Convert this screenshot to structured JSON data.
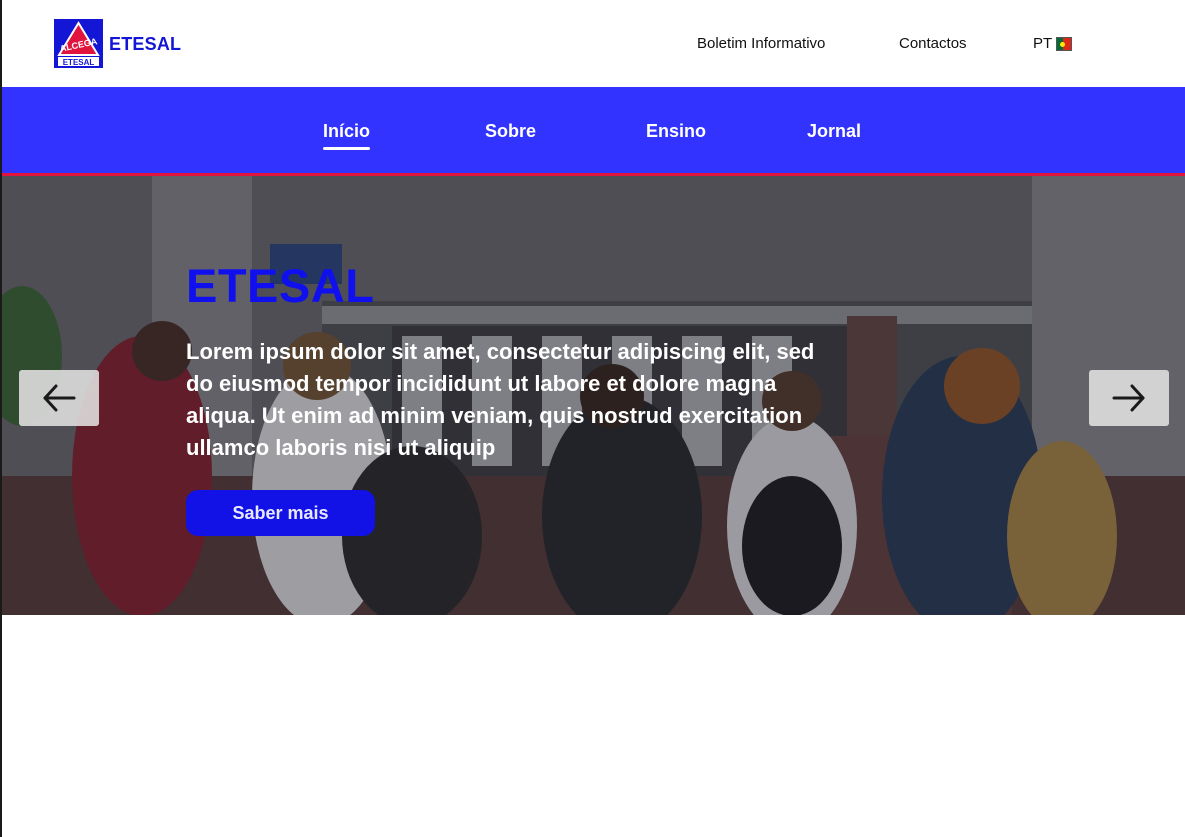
{
  "brand": {
    "logo_text": "ETESAL",
    "name": "ETESAL",
    "color": "#1416d6"
  },
  "top_links": {
    "newsletter": "Boletim Informativo",
    "contacts": "Contactos",
    "language": "PT"
  },
  "nav": {
    "accent": "#3333ff",
    "border": "#e0143c",
    "items": [
      {
        "label": "Início",
        "active": true
      },
      {
        "label": "Sobre",
        "active": false
      },
      {
        "label": "Ensino",
        "active": false
      },
      {
        "label": "Jornal",
        "active": false
      }
    ]
  },
  "hero": {
    "title": "ETESAL",
    "text": "Lorem ipsum dolor sit amet, consectetur adipiscing elit, sed do eiusmod tempor incididunt ut labore et dolore magna aliqua. Ut enim ad minim veniam, quis nostrud exercitation ullamco laboris nisi ut aliquip",
    "button_label": "Saber mais",
    "prev_icon": "arrow-left-icon",
    "next_icon": "arrow-right-icon"
  }
}
